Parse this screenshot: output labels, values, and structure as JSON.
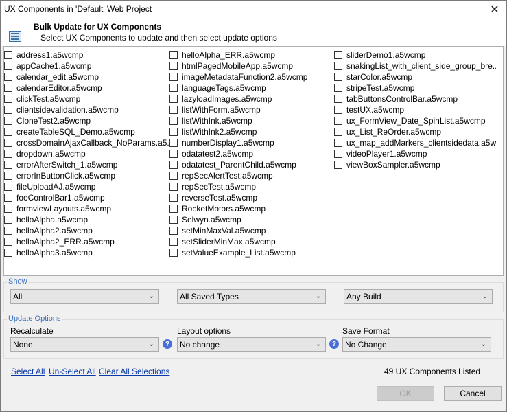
{
  "window": {
    "title": "UX Components in 'Default' Web Project",
    "close_glyph": "✕"
  },
  "header": {
    "title": "Bulk Update for UX Components",
    "subtitle": "Select UX Components to update and then select update options",
    "icon": "list-form-icon"
  },
  "components": {
    "col1": [
      "address1.a5wcmp",
      "appCache1.a5wcmp",
      "calendar_edit.a5wcmp",
      "calendarEditor.a5wcmp",
      "clickTest.a5wcmp",
      "clientsidevalidation.a5wcmp",
      "CloneTest2.a5wcmp",
      "createTableSQL_Demo.a5wcmp",
      "crossDomainAjaxCallback_NoParams.a5...",
      "dropdown.a5wcmp",
      "errorAfterSwitch_1.a5wcmp",
      "errorInButtonClick.a5wcmp",
      "fileUploadAJ.a5wcmp",
      "fooControlBar1.a5wcmp",
      "formviewLayouts.a5wcmp",
      "helloAlpha.a5wcmp",
      "helloAlpha2.a5wcmp",
      "helloAlpha2_ERR.a5wcmp",
      "helloAlpha3.a5wcmp"
    ],
    "col2": [
      "helloAlpha_ERR.a5wcmp",
      "htmlPagedMobileApp.a5wcmp",
      "imageMetadataFunction2.a5wcmp",
      "languageTags.a5wcmp",
      "lazyloadImages.a5wcmp",
      "listWithForm.a5wcmp",
      "listWithInk.a5wcmp",
      "listWithInk2.a5wcmp",
      "numberDisplay1.a5wcmp",
      "odatatest2.a5wcmp",
      "odatatest_ParentChild.a5wcmp",
      "repSecAlertTest.a5wcmp",
      "repSecTest.a5wcmp",
      "reverseTest.a5wcmp",
      "RocketMotors.a5wcmp",
      "Selwyn.a5wcmp",
      "setMinMaxVal.a5wcmp",
      "setSliderMinMax.a5wcmp",
      "setValueExample_List.a5wcmp"
    ],
    "col3": [
      "sliderDemo1.a5wcmp",
      "snakingList_with_client_side_group_bre...",
      "starColor.a5wcmp",
      "stripeTest.a5wcmp",
      "tabButtonsControlBar.a5wcmp",
      "testUX.a5wcmp",
      "ux_FormView_Date_SpinList.a5wcmp",
      "ux_List_ReOrder.a5wcmp",
      "ux_map_addMarkers_clientsidedata.a5w...",
      "videoPlayer1.a5wcmp",
      "viewBoxSampler.a5wcmp"
    ]
  },
  "show": {
    "label": "Show",
    "filter1": "All",
    "filter2": "All Saved Types",
    "filter3": "Any Build"
  },
  "update_options": {
    "label": "Update Options",
    "recalculate_label": "Recalculate",
    "recalculate_value": "None",
    "layout_label": "Layout options",
    "layout_value": "No change",
    "save_format_label": "Save Format",
    "save_format_value": "No Change",
    "help_glyph": "?"
  },
  "footer": {
    "select_all": "Select All",
    "unselect_all": "Un-Select All",
    "clear_all": "Clear All Selections",
    "status": "49 UX Components Listed",
    "ok": "OK",
    "cancel": "Cancel"
  },
  "chevron": "⌄"
}
